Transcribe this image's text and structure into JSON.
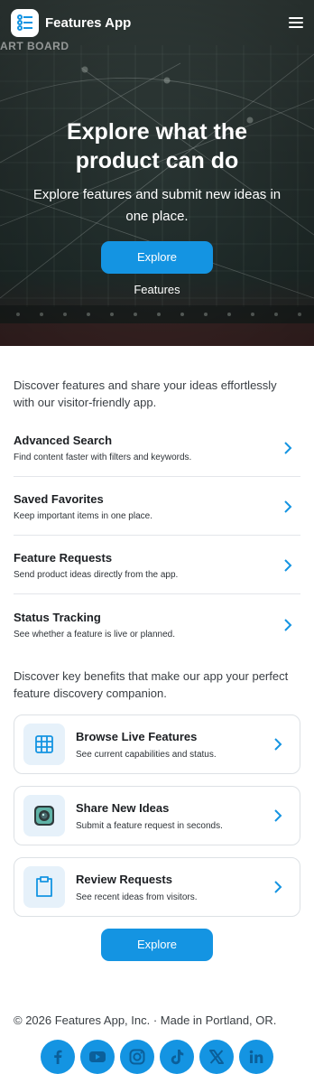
{
  "header": {
    "brand": "Features App",
    "menu_icon": "hamburger-icon",
    "logo_icon": "list-icon"
  },
  "hero": {
    "board_text": "ART BOARD",
    "title": "Explore what the product can do",
    "subtitle": "Explore features and submit new ideas in one place.",
    "cta_label": "Explore Features"
  },
  "intro": "Discover features and share your ideas effortlessly with our visitor-friendly app.",
  "features": [
    {
      "title": "Advanced Search",
      "desc": "Find content faster with filters and keywords."
    },
    {
      "title": "Saved Favorites",
      "desc": "Keep important items in one place."
    },
    {
      "title": "Feature Requests",
      "desc": "Send product ideas directly from the app."
    },
    {
      "title": "Status Tracking",
      "desc": "See whether a feature is live or planned."
    }
  ],
  "benefits_intro": "Discover key benefits that make our app your perfect feature discovery companion.",
  "cards": [
    {
      "title": "Browse Live Features",
      "desc": "See current capabilities and status.",
      "icon": "grid-icon"
    },
    {
      "title": "Share New Ideas",
      "desc": "Submit a feature request in seconds.",
      "icon": "camera-icon"
    },
    {
      "title": "Review Requests",
      "desc": "See recent ideas from visitors.",
      "icon": "clipboard-icon"
    }
  ],
  "cta_label": "Explore Features",
  "footer": {
    "copyright": "© 2026 Features App, Inc. · Made in Portland, OR.",
    "socials": [
      "facebook-icon",
      "youtube-icon",
      "instagram-icon",
      "tiktok-icon",
      "x-icon",
      "linkedin-icon"
    ]
  },
  "colors": {
    "accent": "#1494e2",
    "card_icon_bg": "#e6f1fa"
  }
}
